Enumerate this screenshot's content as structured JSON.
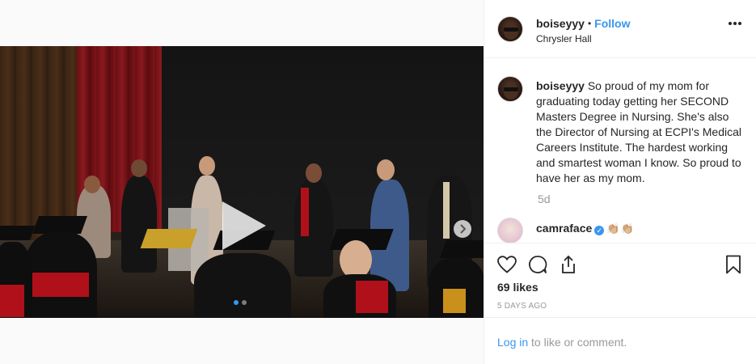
{
  "post": {
    "username": "boiseyyy",
    "separator": "•",
    "follow_label": "Follow",
    "location": "Chrysler Hall",
    "caption": "So proud of my mom for graduating today getting her SECOND Masters Degree in Nursing. She's also the Director of Nursing at ECPI's Medical Careers Institute. The hardest working and smartest woman I know. So proud to have her as my mom.",
    "caption_time": "5d",
    "comments": [
      {
        "username": "camraface",
        "verified": true,
        "text": "👏🏼👏🏼"
      }
    ],
    "likes": "69 likes",
    "time_ago": "5 DAYS AGO"
  },
  "media": {
    "type": "video",
    "carousel_dots": 2,
    "active_dot": 0
  },
  "footer": {
    "login_link": "Log in",
    "login_suffix": " to like or comment."
  },
  "icons": {
    "like": "heart-icon",
    "comment": "comment-icon",
    "share": "share-icon",
    "save": "bookmark-icon",
    "play": "play-icon",
    "next": "chevron-right-icon",
    "more": "more-options-icon"
  },
  "colors": {
    "accent": "#3897f0",
    "muted": "#999999",
    "text": "#262626"
  }
}
